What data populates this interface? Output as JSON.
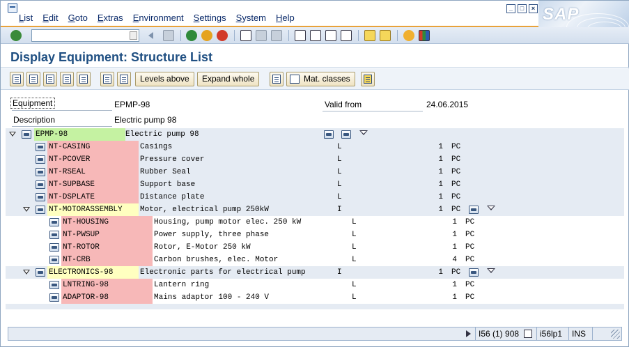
{
  "menu": {
    "items": [
      {
        "label": "List",
        "u": "L",
        "rest": "ist"
      },
      {
        "label": "Edit",
        "u": "E",
        "rest": "dit"
      },
      {
        "label": "Goto",
        "u": "G",
        "rest": "oto"
      },
      {
        "label": "Extras",
        "u": "E",
        "rest": "xtras"
      },
      {
        "label": "Environment",
        "u": "E",
        "rest": "nvironment"
      },
      {
        "label": "Settings",
        "u": "S",
        "rest": "ettings"
      },
      {
        "label": "System",
        "u": "S",
        "rest": "ystem"
      },
      {
        "label": "Help",
        "u": "H",
        "rest": "elp"
      }
    ]
  },
  "brand": {
    "logo_text": "SAP"
  },
  "command_field": {
    "value": ""
  },
  "title": "Display Equipment: Structure List",
  "app_toolbar": {
    "levels_above": "Levels above",
    "expand_whole": "Expand whole",
    "mat_classes": "Mat. classes"
  },
  "header": {
    "equipment_label": "Equipment",
    "equipment_value": "EPMP-98",
    "description_label": "Description",
    "description_value": "Electric pump 98",
    "valid_from_label": "Valid from",
    "valid_from_value": "24.06.2015"
  },
  "tree": {
    "root": {
      "id": "EPMP-98",
      "desc": "Electric pump 98"
    },
    "rows": [
      {
        "id": "NT-CASING",
        "desc": "Casings",
        "cat": "L",
        "qty": "1",
        "unit": "PC"
      },
      {
        "id": "NT-PCOVER",
        "desc": "Pressure cover",
        "cat": "L",
        "qty": "1",
        "unit": "PC"
      },
      {
        "id": "NT-RSEAL",
        "desc": "Rubber Seal",
        "cat": "L",
        "qty": "1",
        "unit": "PC"
      },
      {
        "id": "NT-SUPBASE",
        "desc": "Support base",
        "cat": "L",
        "qty": "1",
        "unit": "PC"
      },
      {
        "id": "NT-DSPLATE",
        "desc": "Distance plate",
        "cat": "L",
        "qty": "1",
        "unit": "PC"
      },
      {
        "id": "NT-MOTORASSEMBLY",
        "desc": "Motor, electrical pump 250kW",
        "cat": "I",
        "qty": "1",
        "unit": "PC"
      },
      {
        "id": "NT-HOUSING",
        "desc": "Housing, pump motor elec. 250 kW",
        "cat": "L",
        "qty": "1",
        "unit": "PC"
      },
      {
        "id": "NT-PWSUP",
        "desc": "Power supply, three phase",
        "cat": "L",
        "qty": "1",
        "unit": "PC"
      },
      {
        "id": "NT-ROTOR",
        "desc": "Rotor, E-Motor 250 kW",
        "cat": "L",
        "qty": "1",
        "unit": "PC"
      },
      {
        "id": "NT-CRB",
        "desc": "Carbon brushes, elec. Motor",
        "cat": "L",
        "qty": "4",
        "unit": "PC"
      },
      {
        "id": "ELECTRONICS-98",
        "desc": "Electronic parts for electrical pump",
        "cat": "I",
        "qty": "1",
        "unit": "PC"
      },
      {
        "id": "LNTRING-98",
        "desc": "Lantern ring",
        "cat": "L",
        "qty": "1",
        "unit": "PC"
      },
      {
        "id": "ADAPTOR-98",
        "desc": "Mains adaptor 100 - 240 V",
        "cat": "L",
        "qty": "1",
        "unit": "PC"
      }
    ]
  },
  "status": {
    "system": "I56 (1) 908",
    "server": "i56lp1",
    "mode": "INS"
  },
  "colors": {
    "title": "#1f4f82",
    "root_highlight": "#c5f2a2",
    "component_highlight": "#f7b8b8",
    "assembly_highlight": "#ffffc0"
  }
}
